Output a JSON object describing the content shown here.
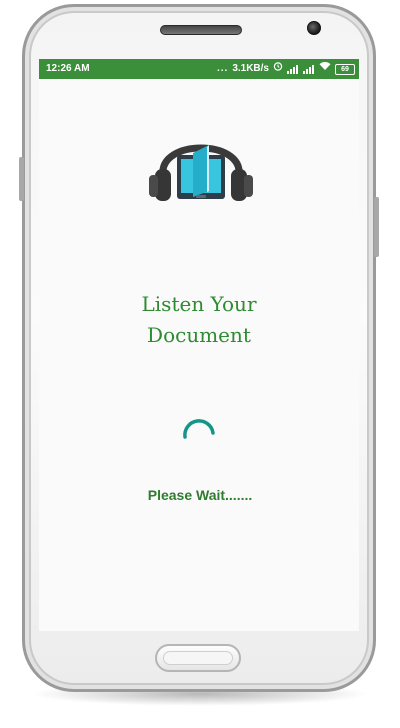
{
  "status_bar": {
    "time": "12:26 AM",
    "dots": "...",
    "speed": "3.1KB/s",
    "battery": "69",
    "color": "#3b8e3a"
  },
  "app": {
    "title_line1": "Listen Your",
    "title_line2": "Document",
    "loading_text": "Please Wait.......",
    "accent_color": "#2e8b31",
    "spinner_color": "#13968a",
    "logo_icon": "headphones-book-icon"
  }
}
